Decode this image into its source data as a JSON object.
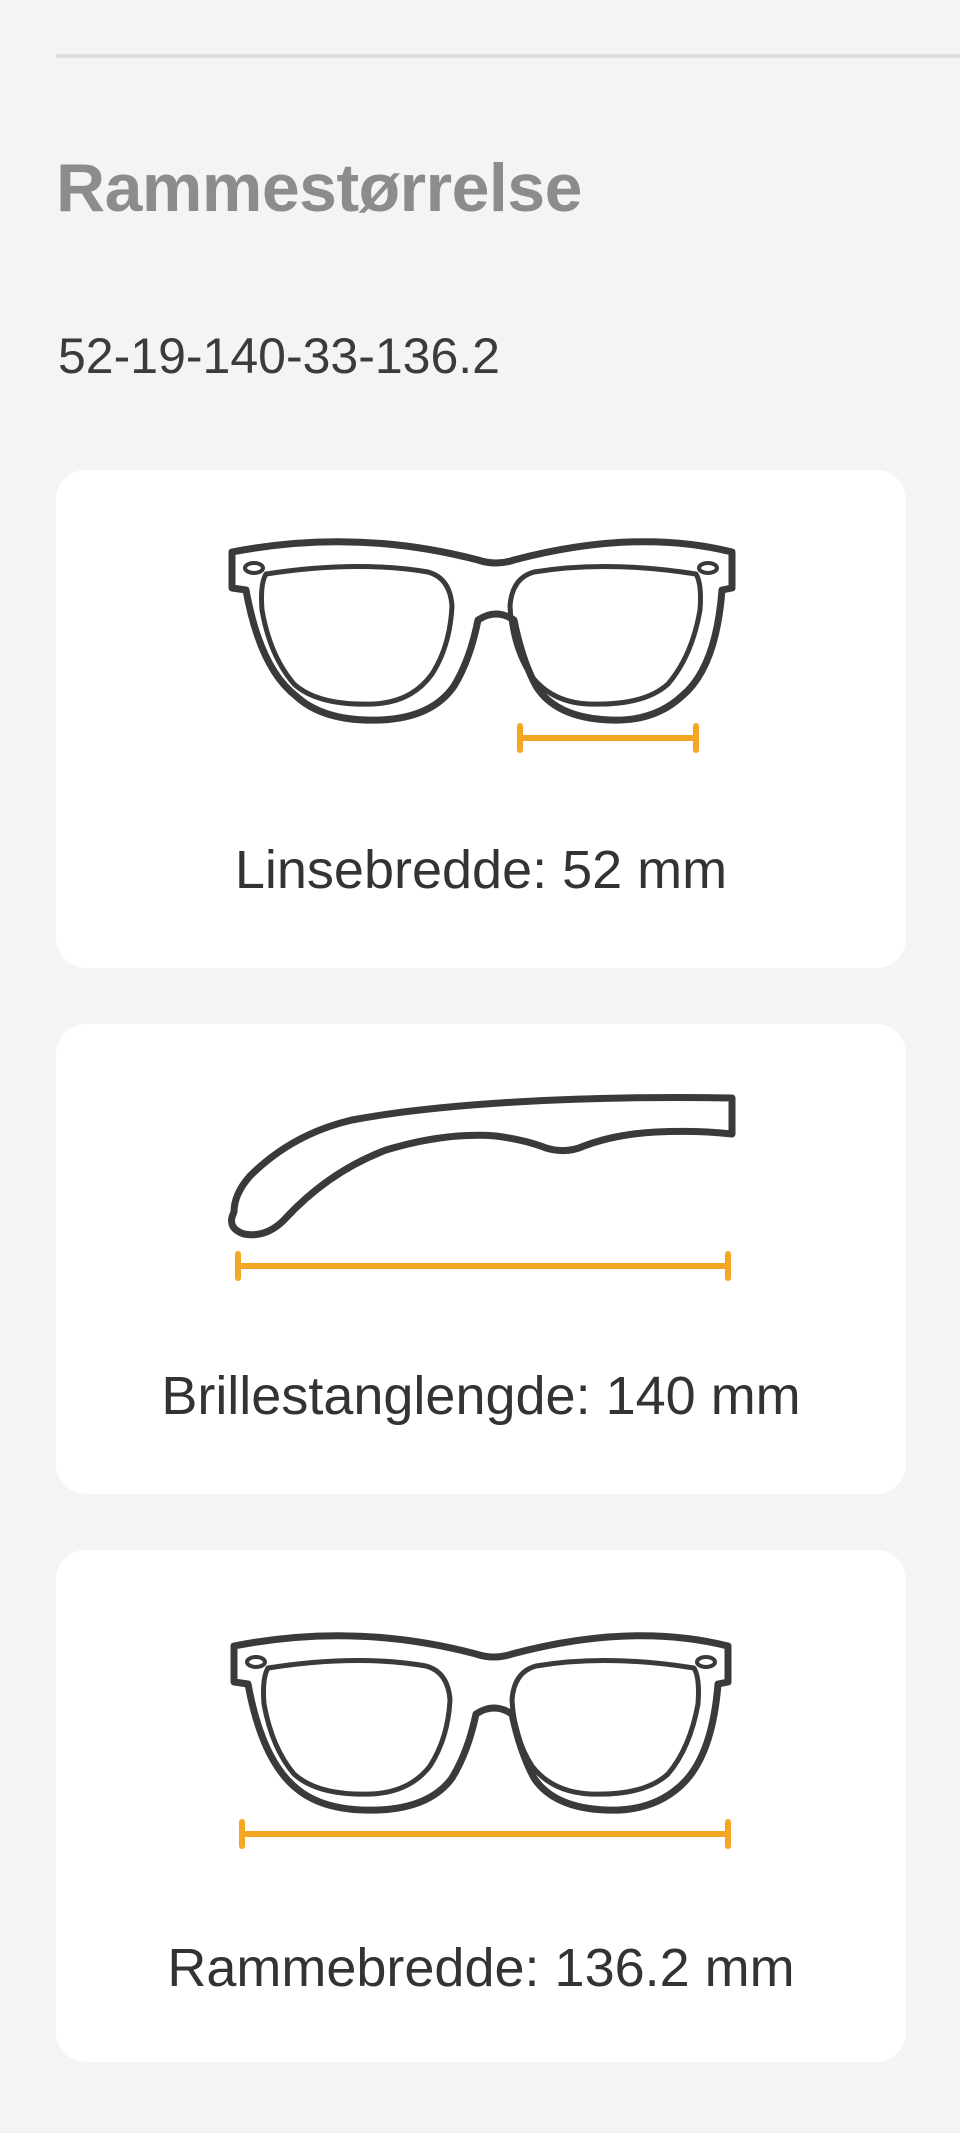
{
  "section": {
    "title": "Rammestørrelse",
    "size_code": "52-19-140-33-136.2"
  },
  "measurements": [
    {
      "id": "lens-width",
      "label": "Linsebredde: 52 mm",
      "icon": "glasses-front-lens-icon",
      "value_mm": 52
    },
    {
      "id": "temple-length",
      "label": "Brillestanglengde: 140 mm",
      "icon": "glasses-temple-icon",
      "value_mm": 140
    },
    {
      "id": "frame-width",
      "label": "Rammebredde: 136.2 mm",
      "icon": "glasses-front-frame-icon",
      "value_mm": 136.2
    }
  ],
  "colors": {
    "background": "#f4f4f4",
    "card": "#ffffff",
    "title": "#8c8c8c",
    "text": "#333333",
    "frame_outline": "#3a3a3a",
    "measure_accent": "#f5a623"
  }
}
